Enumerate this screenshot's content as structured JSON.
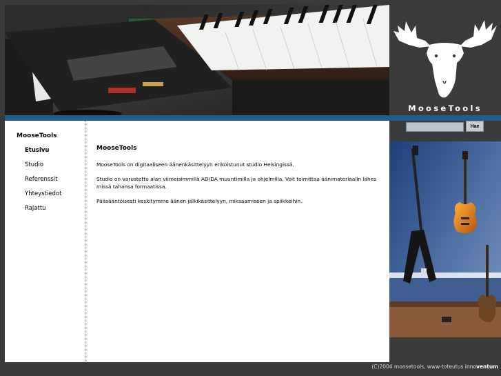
{
  "logo": {
    "text": "MooseTools",
    "icon": "moose-head-icon"
  },
  "nav": {
    "title": "MooseTools",
    "items": [
      {
        "label": "Etusivu",
        "active": true
      },
      {
        "label": "Studio",
        "active": false
      },
      {
        "label": "Referenssit",
        "active": false
      },
      {
        "label": "Yhteystiedot",
        "active": false
      },
      {
        "label": "Rajattu",
        "active": false
      }
    ]
  },
  "main": {
    "heading": "MooseTools",
    "paragraphs": [
      "MooseTools on digitaaliseen äänenkäsittelyyn erikoistunut studio Helsingissä.",
      "Studio on varustettu alan viimeisimmillä AD/DA muuntimilla ja ohjelmilla. Voit toimittaa äänimateriaalin lähes missä tahansa formaatissa.",
      "Pääsääntöisesti keskitymme äänen jälkikäsittelyyn, miksaamiseen ja spiikkeihin."
    ]
  },
  "search": {
    "button_label": "Hae",
    "value": ""
  },
  "footer": {
    "copyright": "(C)2004 moosetools, www-toteutus",
    "brand_pre": "inno",
    "brand_bold": "ventum"
  },
  "colors": {
    "accent_bar": "#1e5d8c",
    "background": "#3a3a3a"
  }
}
